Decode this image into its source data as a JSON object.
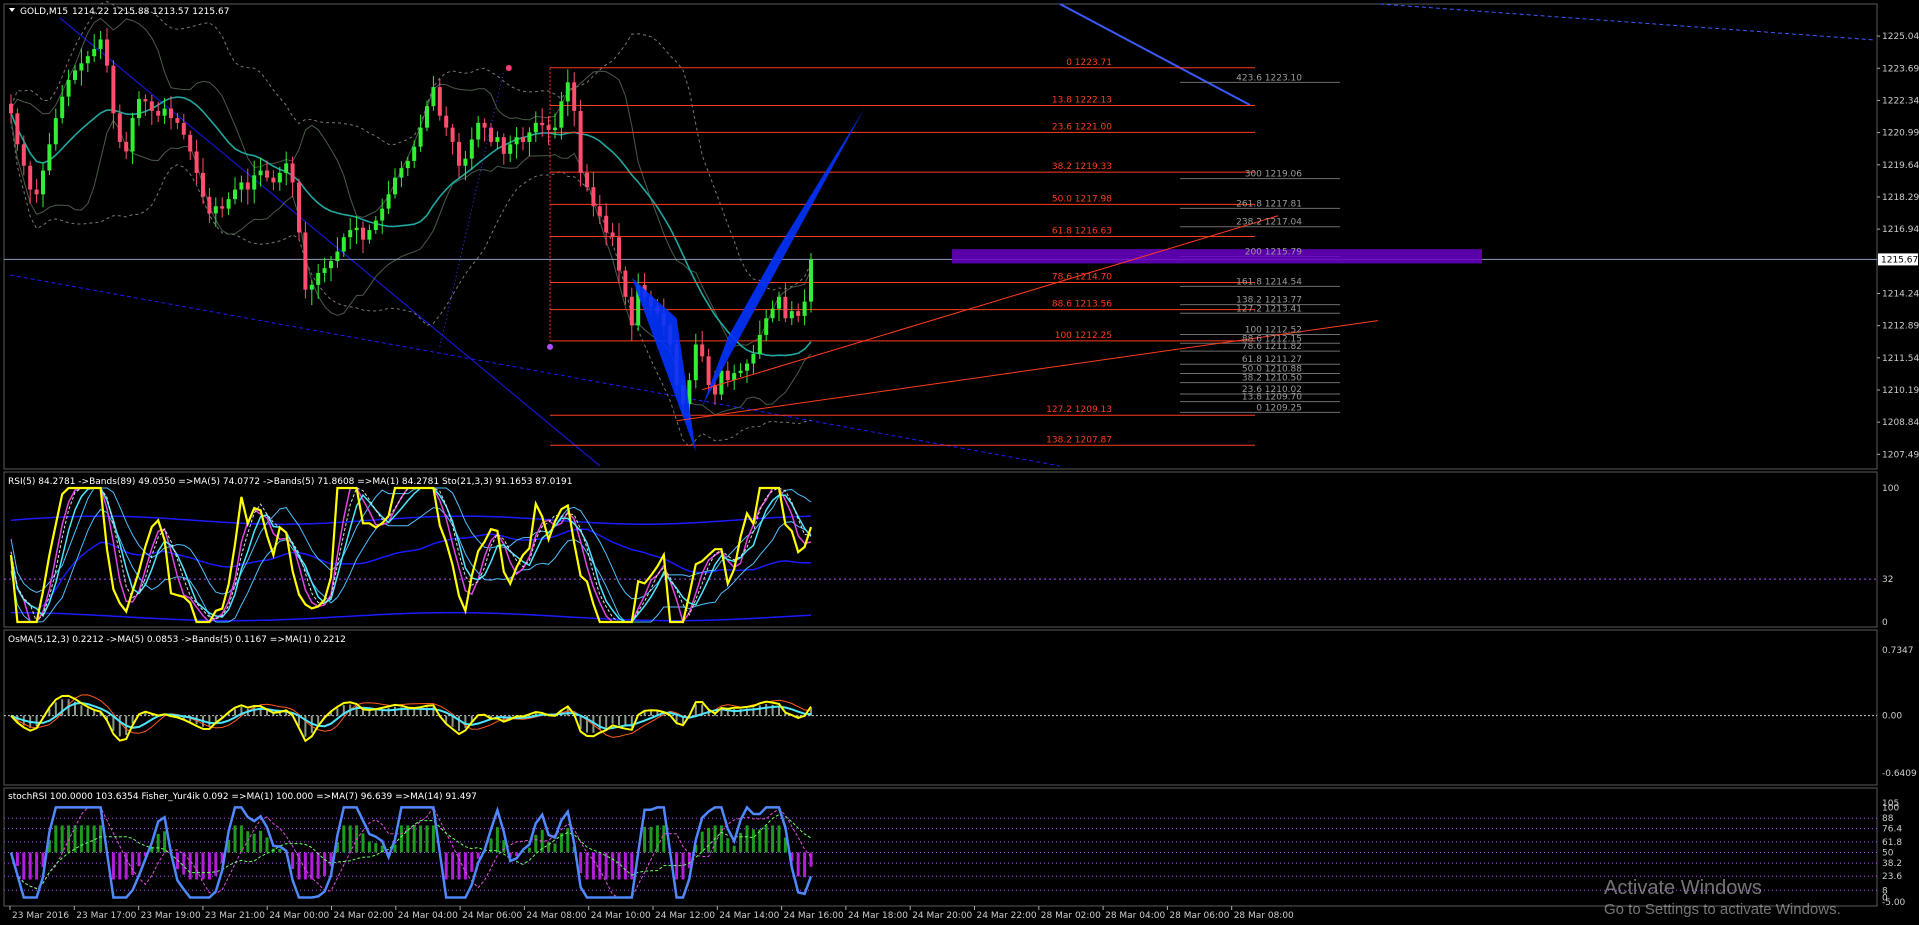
{
  "window": {
    "title": "GOLD,M15",
    "ohlc": "1214.22 1215.88 1213.57 1215.67"
  },
  "watermark": {
    "line1": "Activate Windows",
    "line2": "Go to Settings to activate Windows."
  },
  "colors": {
    "background": "#000000",
    "bull": "#33ee33",
    "bear": "#ff4d6d",
    "fib": "#ff3c1e",
    "fib_ext": "#6e6e6e",
    "harmonic": "#0033ff",
    "zone": "#6a00c8",
    "teal": "#1fa8a0",
    "yellow": "#ffff00",
    "cyan": "#4ee6ff",
    "magenta": "#e046e0",
    "blue_band": "#1a1aff",
    "stoch_line": "#4f88ff"
  },
  "chart_data": [
    {
      "type": "candlestick",
      "title": "GOLD,M15",
      "ylim": [
        1207.0,
        1225.8
      ],
      "price_ticks": [
        "1225.04",
        "1223.69",
        "1222.34",
        "1220.99",
        "1219.64",
        "1218.29",
        "1216.94",
        "1215.67",
        "1214.24",
        "1212.89",
        "1211.54",
        "1210.19",
        "1208.84",
        "1207.49"
      ],
      "current_price": "1215.67",
      "time_labels": [
        "23 Mar 2016",
        "23 Mar 17:00",
        "23 Mar 19:00",
        "23 Mar 21:00",
        "24 Mar 00:00",
        "24 Mar 02:00",
        "24 Mar 04:00",
        "24 Mar 06:00",
        "24 Mar 08:00",
        "24 Mar 10:00",
        "24 Mar 12:00",
        "24 Mar 14:00",
        "24 Mar 16:00",
        "24 Mar 18:00",
        "24 Mar 20:00",
        "24 Mar 22:00",
        "28 Mar 02:00",
        "28 Mar 04:00",
        "28 Mar 06:00",
        "28 Mar 08:00"
      ],
      "closes": [
        1221.8,
        1220.5,
        1219.6,
        1218.6,
        1218.4,
        1219.4,
        1220.5,
        1221.6,
        1222.5,
        1223.2,
        1223.6,
        1223.9,
        1224.2,
        1224.5,
        1224.9,
        1223.8,
        1221.8,
        1220.6,
        1220.2,
        1221.6,
        1222.4,
        1222.3,
        1221.9,
        1221.7,
        1222.0,
        1221.6,
        1221.4,
        1220.9,
        1220.2,
        1219.3,
        1218.3,
        1217.6,
        1217.9,
        1217.8,
        1218.2,
        1218.6,
        1218.9,
        1218.6,
        1219.2,
        1219.4,
        1219.1,
        1218.9,
        1219.3,
        1219.7,
        1218.9,
        1216.8,
        1214.4,
        1214.6,
        1215.1,
        1215.3,
        1215.6,
        1216.0,
        1216.6,
        1216.9,
        1217.0,
        1216.5,
        1216.9,
        1217.3,
        1217.8,
        1218.4,
        1219.1,
        1219.5,
        1219.8,
        1220.4,
        1221.2,
        1222.1,
        1222.9,
        1221.7,
        1221.2,
        1220.6,
        1219.6,
        1219.9,
        1220.7,
        1221.4,
        1221.2,
        1220.6,
        1220.8,
        1220.1,
        1220.5,
        1220.8,
        1220.6,
        1221.0,
        1221.4,
        1221.3,
        1221.1,
        1221.2,
        1222.3,
        1223.1,
        1221.9,
        1219.3,
        1218.7,
        1217.9,
        1217.5,
        1216.8,
        1216.6,
        1215.2,
        1214.1,
        1212.9,
        1214.6,
        1214.1,
        1213.7,
        1213.4,
        1212.9,
        1212.1,
        1210.4,
        1209.6,
        1210.6,
        1212.1,
        1211.6,
        1210.4,
        1210.0,
        1211.0,
        1210.6,
        1210.9,
        1211.0,
        1211.3,
        1211.7,
        1212.5,
        1213.2,
        1213.6,
        1214.1,
        1213.2,
        1213.5,
        1213.3,
        1213.9,
        1215.67
      ],
      "fibonacci_retracement": [
        {
          "label": "0 1223.71",
          "price": 1223.71
        },
        {
          "label": "13.8 1222.13",
          "price": 1222.13
        },
        {
          "label": "23.6 1221.00",
          "price": 1221.0
        },
        {
          "label": "38.2 1219.33",
          "price": 1219.33
        },
        {
          "label": "50.0 1217.98",
          "price": 1217.98
        },
        {
          "label": "61.8 1216.63",
          "price": 1216.63
        },
        {
          "label": "78.6 1214.70",
          "price": 1214.7
        },
        {
          "label": "88.6 1213.56",
          "price": 1213.56
        },
        {
          "label": "100 1212.25",
          "price": 1212.25
        },
        {
          "label": "127.2 1209.13",
          "price": 1209.13
        },
        {
          "label": "138.2 1207.87",
          "price": 1207.87
        }
      ],
      "fibonacci_extension": [
        {
          "label": "423.6 1223.10",
          "price": 1223.1
        },
        {
          "label": "300 1219.06",
          "price": 1219.06
        },
        {
          "label": "261.8 1217.81",
          "price": 1217.81
        },
        {
          "label": "238.2 1217.04",
          "price": 1217.04
        },
        {
          "label": "200 1215.79",
          "price": 1215.79
        },
        {
          "label": "161.8 1214.54",
          "price": 1214.54
        },
        {
          "label": "138.2 1213.77",
          "price": 1213.77
        },
        {
          "label": "127.2 1213.41",
          "price": 1213.41
        },
        {
          "label": "100 1212.52",
          "price": 1212.52
        },
        {
          "label": "88.6 1212.15",
          "price": 1212.15
        },
        {
          "label": "78.6 1211.82",
          "price": 1211.82
        },
        {
          "label": "61.8 1211.27",
          "price": 1211.27
        },
        {
          "label": "50.0 1210.88",
          "price": 1210.88
        },
        {
          "label": "38.2 1210.50",
          "price": 1210.5
        },
        {
          "label": "23.6 1210.02",
          "price": 1210.02
        },
        {
          "label": "13.8 1209.70",
          "price": 1209.7
        },
        {
          "label": "0 1209.25",
          "price": 1209.25
        }
      ],
      "zone": {
        "from": 1215.5,
        "to": 1216.1
      }
    },
    {
      "type": "line",
      "title": "RSI(5) 84.2781  ->Bands(89) 49.0550  =>MA(5) 74.0772  ->Bands(5) 71.8608  =>MA(1) 84.2781  Sto(21,3,3) 91.1653 87.0191",
      "ylim": [
        0,
        100
      ],
      "ticks": [
        "100",
        "32",
        "0"
      ],
      "levels": [
        32
      ]
    },
    {
      "type": "bar",
      "title": "OsMA(5,12,3) 0.2212  ->MA(5) 0.0853  ->Bands(5) 0.1167  =>MA(1) 0.2212",
      "ylim": [
        -0.72,
        0.78
      ],
      "ticks": [
        "0.7347",
        "0.00",
        "-0.6409"
      ]
    },
    {
      "type": "bar",
      "title": "stochRSI 100.0000 103.6354  Fisher_Yur4ik 0.092  =>MA(1) 100.000  =>MA(7) 96.639  =>MA(14) 91.497",
      "ylim": [
        -5,
        106
      ],
      "ticks": [
        "105",
        "100",
        "88",
        "76.4",
        "61.8",
        "50",
        "38.2",
        "23.6",
        "8",
        "0",
        "-5.00"
      ]
    }
  ]
}
